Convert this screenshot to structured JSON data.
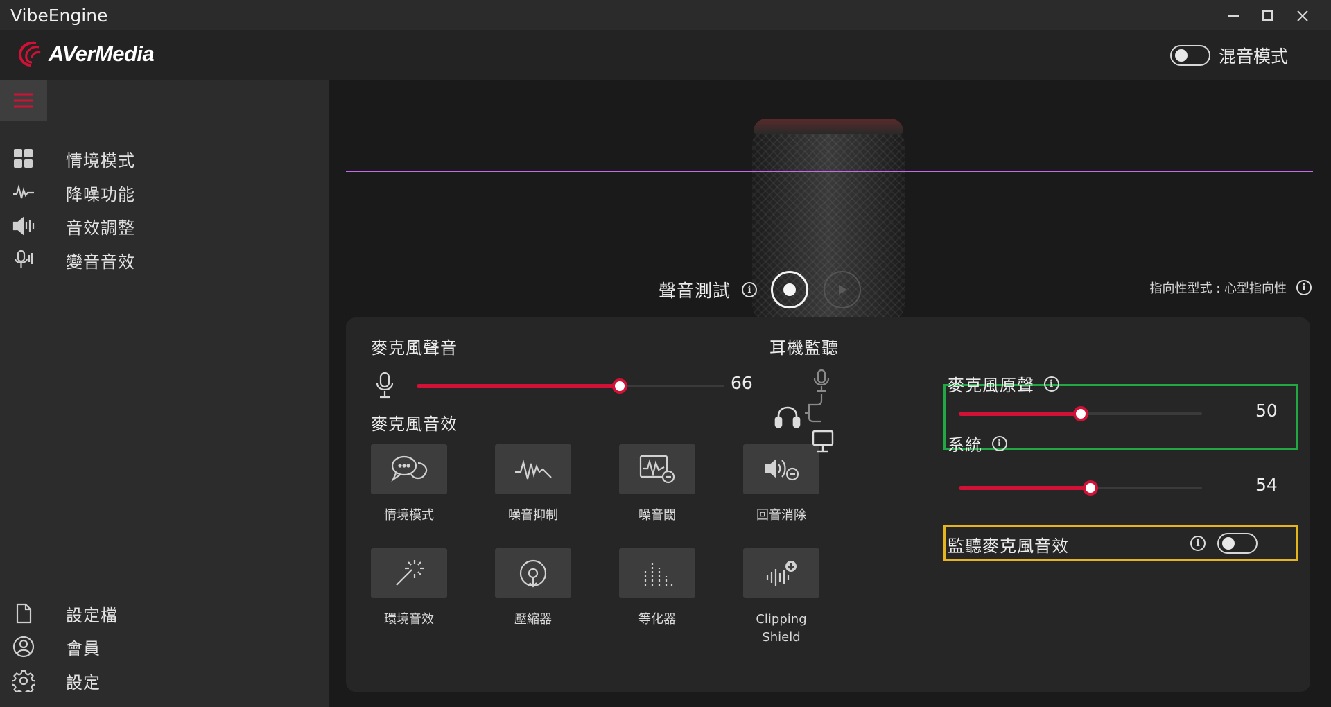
{
  "app": {
    "title": "VibeEngine"
  },
  "header": {
    "brand": "AVerMedia",
    "mix_mode_label": "混音模式",
    "mix_mode_on": false
  },
  "sidebar": {
    "items": [
      {
        "label": "情境模式",
        "icon": "grid-icon"
      },
      {
        "label": "降噪功能",
        "icon": "noise-wave-icon"
      },
      {
        "label": "音效調整",
        "icon": "speaker-icon"
      },
      {
        "label": "變音音效",
        "icon": "voice-change-icon"
      }
    ],
    "bottom_items": [
      {
        "label": "設定檔",
        "icon": "file-icon"
      },
      {
        "label": "會員",
        "icon": "user-icon"
      },
      {
        "label": "設定",
        "icon": "gear-icon"
      }
    ]
  },
  "sound_test": {
    "label": "聲音測試"
  },
  "polar": {
    "label": "指向性型式 : 心型指向性"
  },
  "mic": {
    "title": "麥克風聲音",
    "volume": 66,
    "volume_label": "66",
    "effects_title": "麥克風音效",
    "effects": [
      {
        "label": "情境模式",
        "icon": "chat-bubbles-icon"
      },
      {
        "label": "噪音抑制",
        "icon": "noise-suppression-icon"
      },
      {
        "label": "噪音閾",
        "icon": "noise-gate-icon"
      },
      {
        "label": "回音消除",
        "icon": "echo-cancel-icon"
      },
      {
        "label": "環境音效",
        "icon": "magic-wand-icon"
      },
      {
        "label": "壓縮器",
        "icon": "compressor-icon"
      },
      {
        "label": "等化器",
        "icon": "equalizer-icon"
      },
      {
        "label": "Clipping\nShield",
        "icon": "clipping-shield-icon"
      }
    ]
  },
  "monitor": {
    "title": "耳機監聽",
    "mic_raw": {
      "label": "麥克風原聲",
      "value": 50,
      "value_label": "50"
    },
    "system": {
      "label": "系統",
      "value": 54,
      "value_label": "54"
    },
    "monitor_fx": {
      "label": "監聽麥克風音效",
      "on": false
    }
  },
  "colors": {
    "accent": "#d11136",
    "wave": "#a63ee0",
    "green_box": "#22a745",
    "yellow_box": "#e6b51d"
  }
}
